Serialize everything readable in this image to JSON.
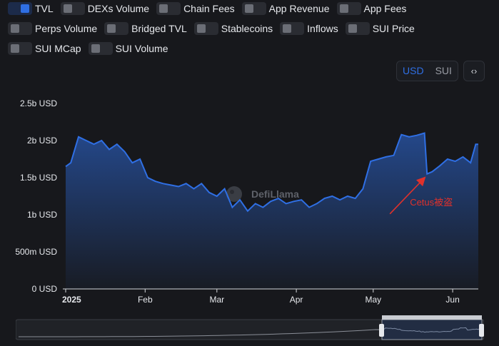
{
  "toggles": [
    [
      {
        "label": "TVL",
        "on": true
      },
      {
        "label": "DEXs Volume",
        "on": false
      },
      {
        "label": "Chain Fees",
        "on": false
      },
      {
        "label": "App Revenue",
        "on": false
      },
      {
        "label": "App Fees",
        "on": false
      }
    ],
    [
      {
        "label": "Perps Volume",
        "on": false
      },
      {
        "label": "Bridged TVL",
        "on": false
      },
      {
        "label": "Stablecoins",
        "on": false
      },
      {
        "label": "Inflows",
        "on": false
      },
      {
        "label": "SUI Price",
        "on": false
      }
    ],
    [
      {
        "label": "SUI MCap",
        "on": false
      },
      {
        "label": "SUI Volume",
        "on": false
      }
    ]
  ],
  "currency": {
    "options": [
      "USD",
      "SUI"
    ],
    "selected": "USD"
  },
  "embed_icon": "‹›",
  "watermark": "DefiLlama",
  "colors": {
    "accent": "#2f6fe4",
    "line": "#2f6fe4",
    "annotation": "#e0312b"
  },
  "chart_data": {
    "type": "area",
    "series": [
      {
        "name": "TVL",
        "x": [
          "2025-01-01",
          "2025-01-03",
          "2025-01-06",
          "2025-01-09",
          "2025-01-12",
          "2025-01-15",
          "2025-01-18",
          "2025-01-21",
          "2025-01-24",
          "2025-01-27",
          "2025-01-30",
          "2025-02-02",
          "2025-02-05",
          "2025-02-08",
          "2025-02-11",
          "2025-02-14",
          "2025-02-17",
          "2025-02-20",
          "2025-02-23",
          "2025-02-26",
          "2025-03-01",
          "2025-03-04",
          "2025-03-07",
          "2025-03-10",
          "2025-03-13",
          "2025-03-16",
          "2025-03-19",
          "2025-03-22",
          "2025-03-25",
          "2025-03-28",
          "2025-03-31",
          "2025-04-03",
          "2025-04-06",
          "2025-04-09",
          "2025-04-12",
          "2025-04-15",
          "2025-04-18",
          "2025-04-21",
          "2025-04-24",
          "2025-04-27",
          "2025-04-30",
          "2025-05-03",
          "2025-05-06",
          "2025-05-09",
          "2025-05-12",
          "2025-05-15",
          "2025-05-18",
          "2025-05-21",
          "2025-05-22",
          "2025-05-24",
          "2025-05-27",
          "2025-05-30",
          "2025-06-02",
          "2025-06-05",
          "2025-06-08",
          "2025-06-10",
          "2025-06-11"
        ],
        "values": [
          1.65,
          1.7,
          2.05,
          2.0,
          1.95,
          2.0,
          1.88,
          1.95,
          1.85,
          1.7,
          1.75,
          1.5,
          1.45,
          1.42,
          1.4,
          1.38,
          1.42,
          1.35,
          1.42,
          1.3,
          1.25,
          1.35,
          1.1,
          1.2,
          1.05,
          1.15,
          1.1,
          1.18,
          1.22,
          1.15,
          1.18,
          1.2,
          1.1,
          1.15,
          1.22,
          1.25,
          1.2,
          1.25,
          1.22,
          1.35,
          1.72,
          1.75,
          1.78,
          1.8,
          2.08,
          2.05,
          2.07,
          2.1,
          1.55,
          1.58,
          1.66,
          1.75,
          1.72,
          1.78,
          1.7,
          1.95,
          1.95
        ]
      }
    ],
    "x_ticks": [
      {
        "x": "2025-01-01",
        "label": "2025"
      },
      {
        "x": "2025-02-01",
        "label": "Feb"
      },
      {
        "x": "2025-03-01",
        "label": "Mar"
      },
      {
        "x": "2025-04-01",
        "label": "Apr"
      },
      {
        "x": "2025-05-01",
        "label": "May"
      },
      {
        "x": "2025-06-01",
        "label": "Jun"
      }
    ],
    "y_ticks": [
      {
        "value": 0,
        "label": "0 USD"
      },
      {
        "value": 0.5,
        "label": "500m USD"
      },
      {
        "value": 1,
        "label": "1b USD"
      },
      {
        "value": 1.5,
        "label": "1.5b USD"
      },
      {
        "value": 2,
        "label": "2b USD"
      },
      {
        "value": 2.5,
        "label": "2.5b USD"
      }
    ],
    "ylim": [
      0,
      2.5
    ],
    "xlim": [
      "2025-01-01",
      "2025-06-11"
    ],
    "unit": "billion USD",
    "annotation": {
      "text": "Cetus被盗",
      "x": "2025-05-22",
      "y": 1.55
    },
    "grid": false,
    "legend": "none"
  }
}
